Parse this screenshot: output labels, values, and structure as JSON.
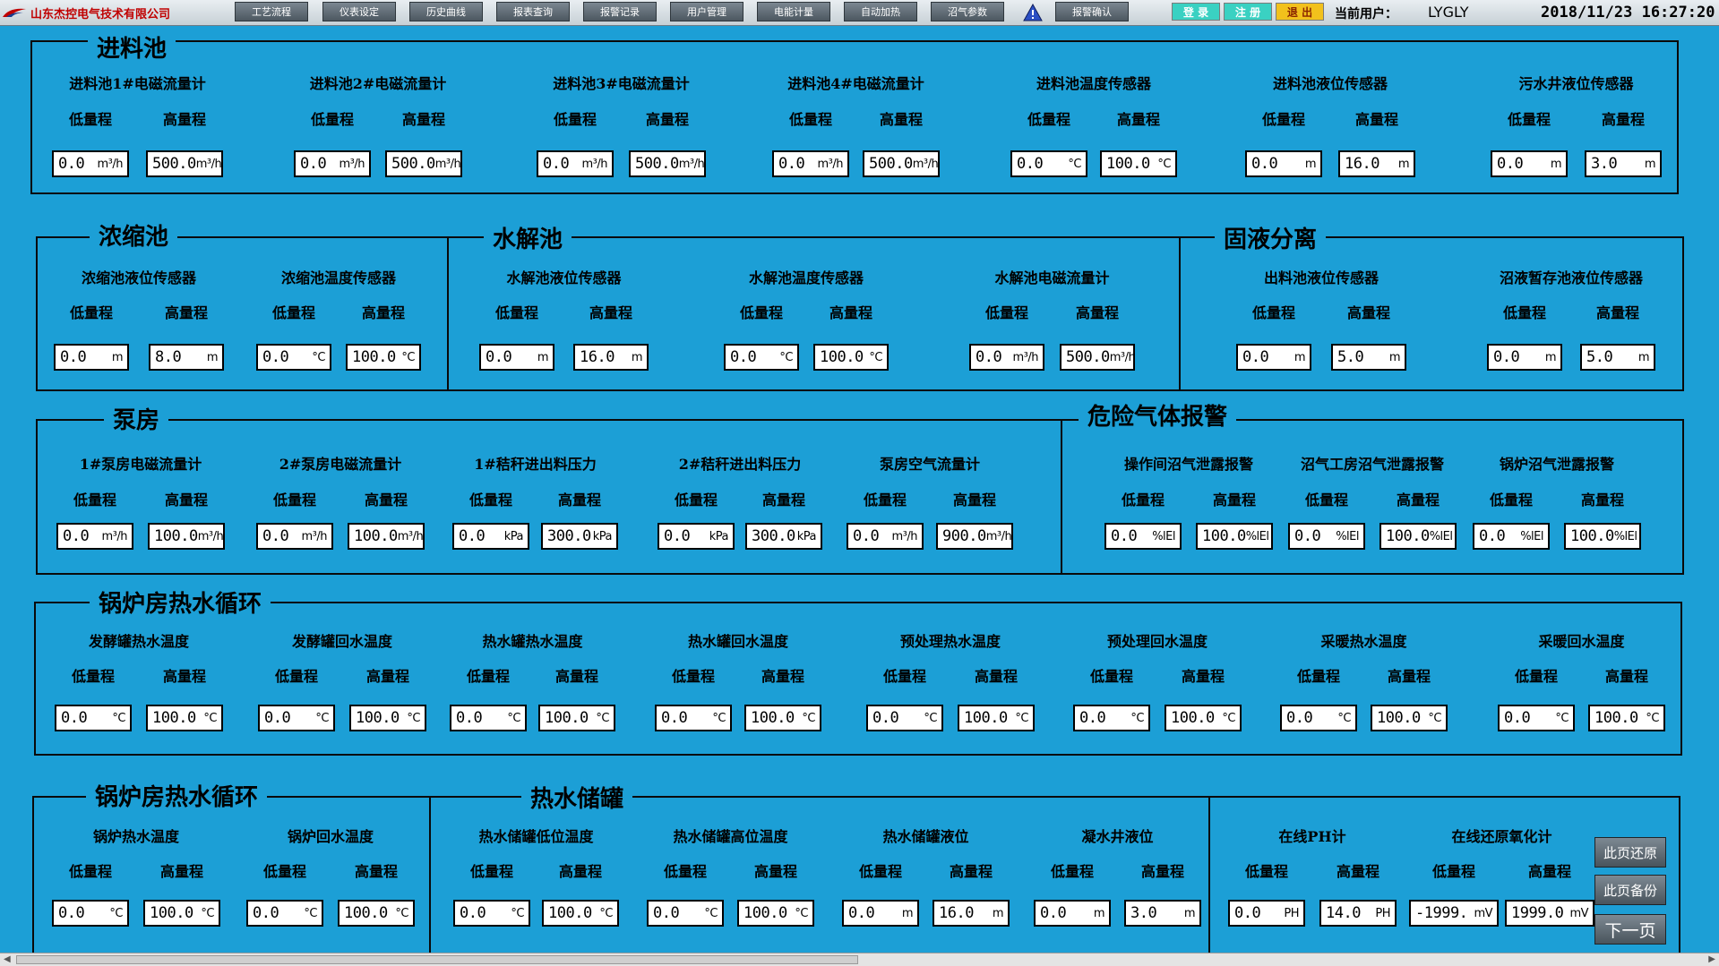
{
  "header": {
    "company": "山东杰控电气技术有限公司",
    "nav": [
      "工艺流程",
      "仪表设定",
      "历史曲线",
      "报表查询",
      "报警记录",
      "用户管理",
      "电能计量",
      "自动加热",
      "沼气参数",
      "报警确认"
    ],
    "auth": {
      "login": "登 录",
      "register": "注 册",
      "logout": "退 出"
    },
    "user_label": "当前用户：",
    "username": "LYGLY",
    "datetime": "2018/11/23 16:27:20"
  },
  "labels": {
    "low": "低量程",
    "high": "高量程"
  },
  "sections": {
    "s1": "进料池",
    "s2": "浓缩池",
    "s3": "水解池",
    "s4": "固液分离",
    "s5": "泵房",
    "s6": "危险气体报警",
    "s7": "锅炉房热水循环",
    "s8": "锅炉房热水循环",
    "s9": "热水储罐"
  },
  "sensors": {
    "r1": [
      "进料池1#电磁流量计",
      "进料池2#电磁流量计",
      "进料池3#电磁流量计",
      "进料池4#电磁流量计",
      "进料池温度传感器",
      "进料池液位传感器",
      "污水井液位传感器"
    ],
    "r2": [
      "浓缩池液位传感器",
      "浓缩池温度传感器",
      "水解池液位传感器",
      "水解池温度传感器",
      "水解池电磁流量计",
      "出料池液位传感器",
      "沼液暂存池液位传感器"
    ],
    "r3": [
      "1#泵房电磁流量计",
      "2#泵房电磁流量计",
      "1#秸秆进出料压力",
      "2#秸秆进出料压力",
      "泵房空气流量计",
      "操作间沼气泄露报警",
      "沼气工房沼气泄露报警",
      "锅炉沼气泄露报警"
    ],
    "r4": [
      "发酵罐热水温度",
      "发酵罐回水温度",
      "热水罐热水温度",
      "热水罐回水温度",
      "预处理热水温度",
      "预处理回水温度",
      "采暖热水温度",
      "采暖回水温度"
    ],
    "r5": [
      "锅炉热水温度",
      "锅炉回水温度",
      "热水储罐低位温度",
      "热水储罐高位温度",
      "热水储罐液位",
      "凝水井液位",
      "在线PH计",
      "在线还原氧化计"
    ]
  },
  "values": {
    "r1": [
      {
        "lo": "0.0",
        "lou": "m³/h",
        "hi": "500.0",
        "hiu": "m³/h"
      },
      {
        "lo": "0.0",
        "lou": "m³/h",
        "hi": "500.0",
        "hiu": "m³/h"
      },
      {
        "lo": "0.0",
        "lou": "m³/h",
        "hi": "500.0",
        "hiu": "m³/h"
      },
      {
        "lo": "0.0",
        "lou": "m³/h",
        "hi": "500.0",
        "hiu": "m³/h"
      },
      {
        "lo": "0.0",
        "lou": "°C",
        "hi": "100.0",
        "hiu": "°C"
      },
      {
        "lo": "0.0",
        "lou": "m",
        "hi": "16.0",
        "hiu": "m"
      },
      {
        "lo": "0.0",
        "lou": "m",
        "hi": "3.0",
        "hiu": "m"
      }
    ],
    "r2": [
      {
        "lo": "0.0",
        "lou": "m",
        "hi": "8.0",
        "hiu": "m"
      },
      {
        "lo": "0.0",
        "lou": "°C",
        "hi": "100.0",
        "hiu": "°C"
      },
      {
        "lo": "0.0",
        "lou": "m",
        "hi": "16.0",
        "hiu": "m"
      },
      {
        "lo": "0.0",
        "lou": "°C",
        "hi": "100.0",
        "hiu": "°C"
      },
      {
        "lo": "0.0",
        "lou": "m³/h",
        "hi": "500.0",
        "hiu": "m³/h"
      },
      {
        "lo": "0.0",
        "lou": "m",
        "hi": "5.0",
        "hiu": "m"
      },
      {
        "lo": "0.0",
        "lou": "m",
        "hi": "5.0",
        "hiu": "m"
      }
    ],
    "r3": [
      {
        "lo": "0.0",
        "lou": "m³/h",
        "hi": "100.0",
        "hiu": "m³/h"
      },
      {
        "lo": "0.0",
        "lou": "m³/h",
        "hi": "100.0",
        "hiu": "m³/h"
      },
      {
        "lo": "0.0",
        "lou": "kPa",
        "hi": "300.0",
        "hiu": "kPa"
      },
      {
        "lo": "0.0",
        "lou": "kPa",
        "hi": "300.0",
        "hiu": "kPa"
      },
      {
        "lo": "0.0",
        "lou": "m³/h",
        "hi": "900.0",
        "hiu": "m³/h"
      },
      {
        "lo": "0.0",
        "lou": "%lEl",
        "hi": "100.0",
        "hiu": "%lEl"
      },
      {
        "lo": "0.0",
        "lou": "%lEl",
        "hi": "100.0",
        "hiu": "%lEl"
      },
      {
        "lo": "0.0",
        "lou": "%lEl",
        "hi": "100.0",
        "hiu": "%lEl"
      }
    ],
    "r4": [
      {
        "lo": "0.0",
        "lou": "°C",
        "hi": "100.0",
        "hiu": "°C"
      },
      {
        "lo": "0.0",
        "lou": "°C",
        "hi": "100.0",
        "hiu": "°C"
      },
      {
        "lo": "0.0",
        "lou": "°C",
        "hi": "100.0",
        "hiu": "°C"
      },
      {
        "lo": "0.0",
        "lou": "°C",
        "hi": "100.0",
        "hiu": "°C"
      },
      {
        "lo": "0.0",
        "lou": "°C",
        "hi": "100.0",
        "hiu": "°C"
      },
      {
        "lo": "0.0",
        "lou": "°C",
        "hi": "100.0",
        "hiu": "°C"
      },
      {
        "lo": "0.0",
        "lou": "°C",
        "hi": "100.0",
        "hiu": "°C"
      },
      {
        "lo": "0.0",
        "lou": "°C",
        "hi": "100.0",
        "hiu": "°C"
      }
    ],
    "r5": [
      {
        "lo": "0.0",
        "lou": "°C",
        "hi": "100.0",
        "hiu": "°C"
      },
      {
        "lo": "0.0",
        "lou": "°C",
        "hi": "100.0",
        "hiu": "°C"
      },
      {
        "lo": "0.0",
        "lou": "°C",
        "hi": "100.0",
        "hiu": "°C"
      },
      {
        "lo": "0.0",
        "lou": "°C",
        "hi": "100.0",
        "hiu": "°C"
      },
      {
        "lo": "0.0",
        "lou": "m",
        "hi": "16.0",
        "hiu": "m"
      },
      {
        "lo": "0.0",
        "lou": "m",
        "hi": "3.0",
        "hiu": "m"
      },
      {
        "lo": "0.0",
        "lou": "PH",
        "hi": "14.0",
        "hiu": "PH"
      },
      {
        "lo": "-1999.",
        "lou": "mV",
        "hi": "1999.0",
        "hiu": "mV"
      }
    ]
  },
  "side_buttons": {
    "restore": "此页还原",
    "backup": "此页备份",
    "next": "下一页"
  },
  "icons": {
    "warning": "warning-triangle-icon",
    "brand": "company-logo-icon"
  },
  "colors": {
    "background": "#1c9fd6",
    "panel_border": "#0a0a0a",
    "value_box": "#ffffff"
  }
}
